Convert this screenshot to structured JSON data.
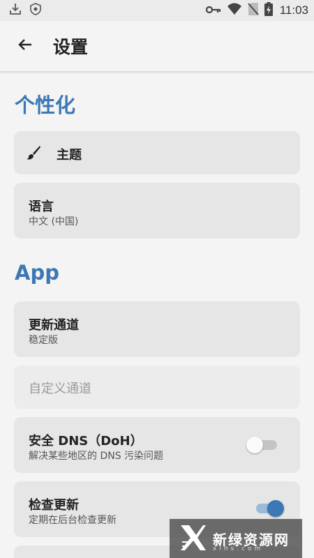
{
  "status_bar": {
    "time": "11:03",
    "icons": [
      "download-icon",
      "shield-icon",
      "key-icon",
      "wifi-icon",
      "no-sim-icon",
      "battery-icon"
    ]
  },
  "app_bar": {
    "title": "设置",
    "back_icon": "arrow-left-icon"
  },
  "sections": {
    "personalization": {
      "title": "个性化",
      "theme": {
        "label": "主题",
        "icon": "brush-icon"
      },
      "language": {
        "label": "语言",
        "value": "中文 (中国)"
      }
    },
    "app": {
      "title": "App",
      "update_channel": {
        "label": "更新通道",
        "value": "稳定版"
      },
      "custom_channel": {
        "placeholder": "自定义通道"
      },
      "secure_dns": {
        "label": "安全 DNS（DoH）",
        "description": "解决某些地区的 DNS 污染问题",
        "enabled": false
      },
      "check_updates": {
        "label": "检查更新",
        "description": "定期在后台检查更新",
        "enabled": true
      }
    }
  },
  "watermark": {
    "text": "新绿资源网",
    "sub": "xlhs.com"
  },
  "colors": {
    "accent": "#3c78b4",
    "card": "#e6e6e6",
    "background": "#f4f4f4"
  }
}
